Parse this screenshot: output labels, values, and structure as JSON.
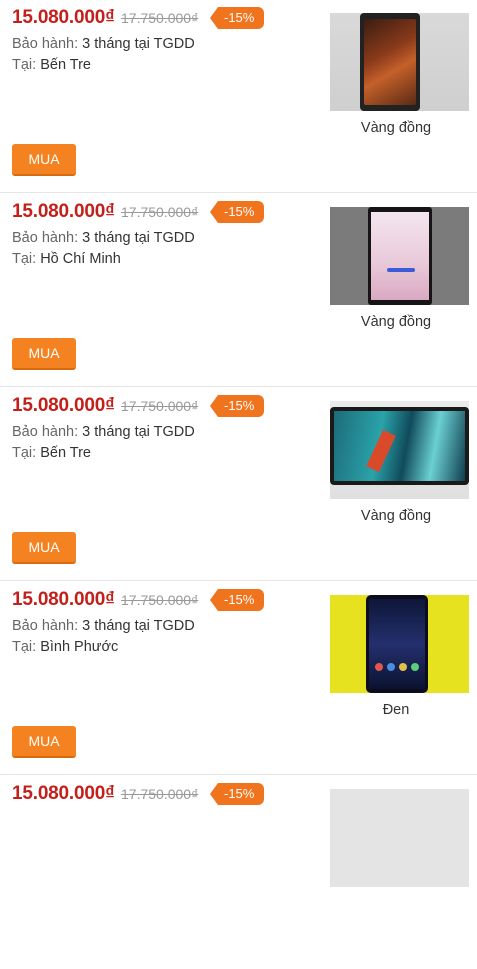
{
  "listings": [
    {
      "price": "15.080.000₫",
      "old_price": "17.750.000₫",
      "discount": "-15%",
      "warranty_label": "Bảo hành:",
      "warranty_value": "3 tháng tại TGDD",
      "location_label": "Tại:",
      "location_value": "Bến Tre",
      "color": "Vàng đồng",
      "buy_label": "MUA"
    },
    {
      "price": "15.080.000₫",
      "old_price": "17.750.000₫",
      "discount": "-15%",
      "warranty_label": "Bảo hành:",
      "warranty_value": "3 tháng tại TGDD",
      "location_label": "Tại:",
      "location_value": "Hồ Chí Minh",
      "color": "Vàng đồng",
      "buy_label": "MUA"
    },
    {
      "price": "15.080.000₫",
      "old_price": "17.750.000₫",
      "discount": "-15%",
      "warranty_label": "Bảo hành:",
      "warranty_value": "3 tháng tại TGDD",
      "location_label": "Tại:",
      "location_value": "Bến Tre",
      "color": "Vàng đồng",
      "buy_label": "MUA"
    },
    {
      "price": "15.080.000₫",
      "old_price": "17.750.000₫",
      "discount": "-15%",
      "warranty_label": "Bảo hành:",
      "warranty_value": "3 tháng tại TGDD",
      "location_label": "Tại:",
      "location_value": "Bình Phước",
      "color": "Đen",
      "buy_label": "MUA"
    },
    {
      "price": "15.080.000₫",
      "old_price": "17.750.000₫",
      "discount": "-15%"
    }
  ],
  "colors": {
    "price": "#c4201b",
    "discount_bg": "#f0731e",
    "buy_bg": "#f58220"
  }
}
